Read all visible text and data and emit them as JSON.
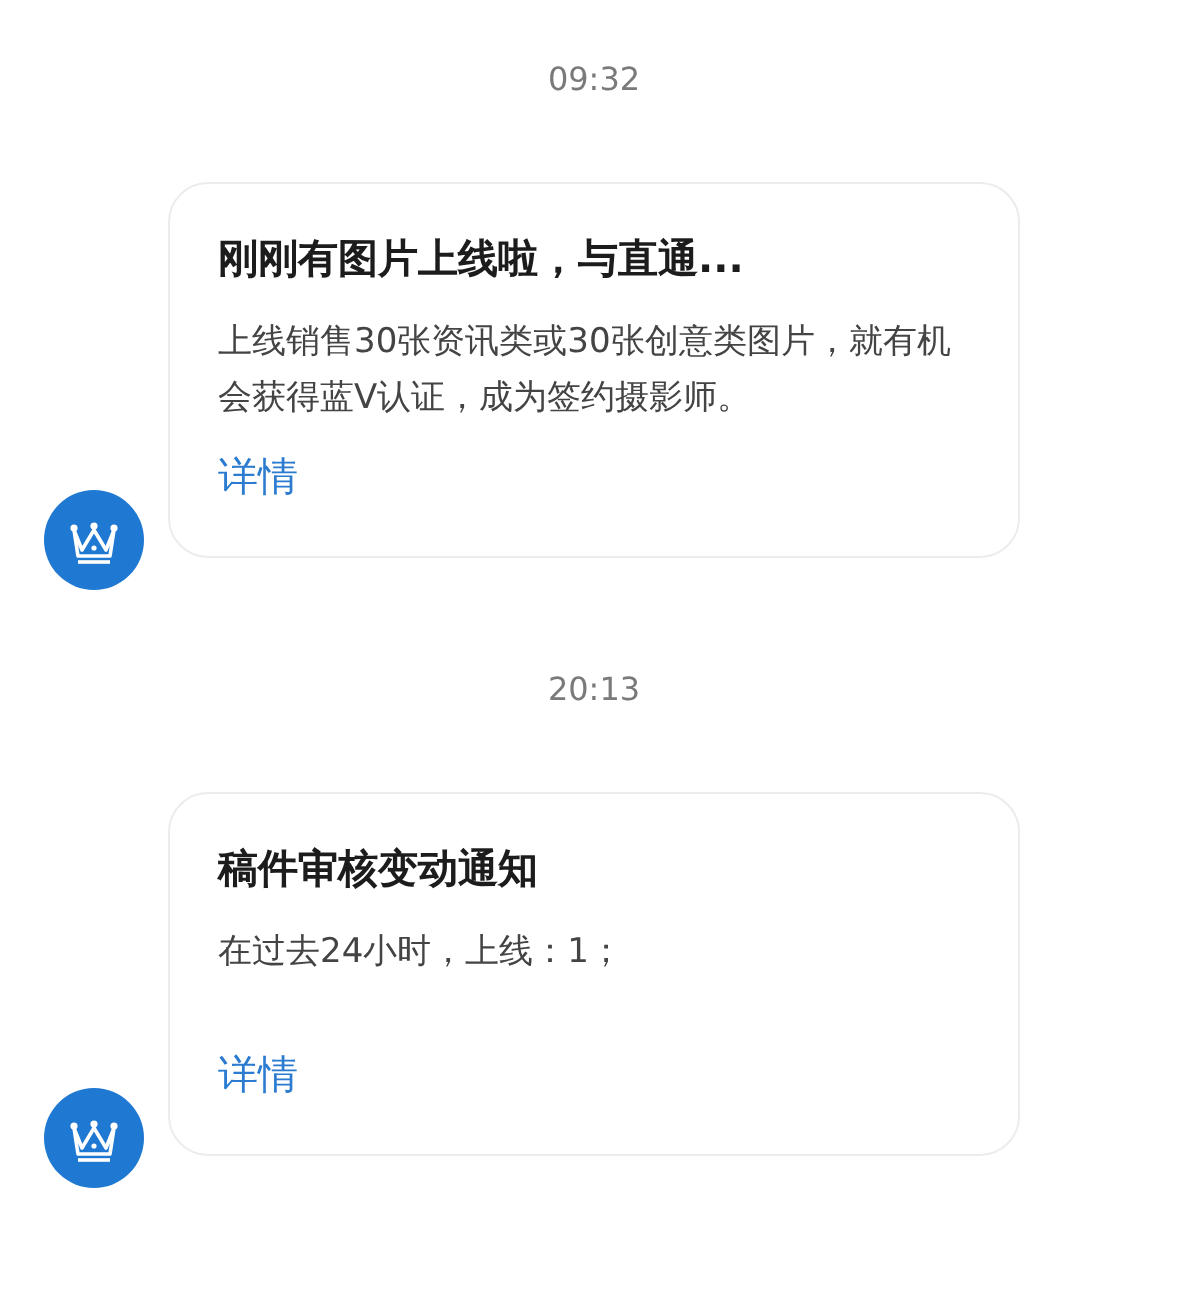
{
  "messages": [
    {
      "time": "09:32",
      "title": "刚刚有图片上线啦，与直通...",
      "body": "上线销售30张资讯类或30张创意类图片，就有机会获得蓝V认证，成为签约摄影师。",
      "link": "详情"
    },
    {
      "time": "20:13",
      "title": "稿件审核变动通知",
      "body": "在过去24小时，上线：1；",
      "link": "详情"
    }
  ]
}
